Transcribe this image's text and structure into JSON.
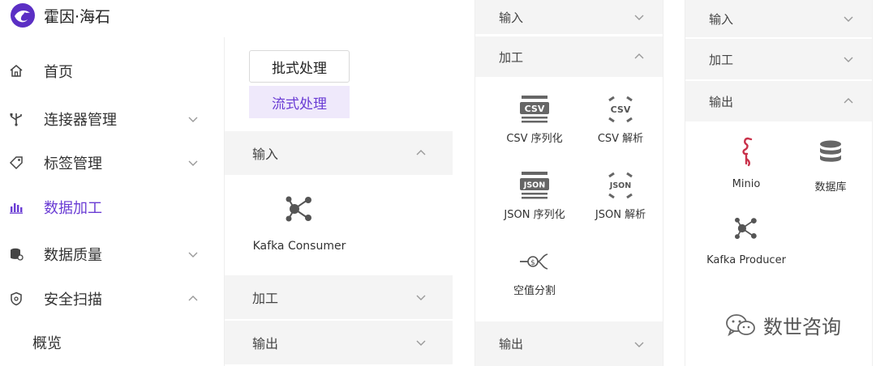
{
  "brand": {
    "name": "霍因·海石"
  },
  "sidebar": {
    "items": [
      {
        "label": "首页",
        "icon": "home-icon"
      },
      {
        "label": "连接器管理",
        "icon": "usb-connector-icon"
      },
      {
        "label": "标签管理",
        "icon": "tag-icon"
      },
      {
        "label": "数据加工",
        "icon": "bar-chart-icon"
      },
      {
        "label": "数据质量",
        "icon": "database-icon"
      },
      {
        "label": "安全扫描",
        "icon": "shield-icon"
      },
      {
        "label": "概览"
      }
    ]
  },
  "panel1": {
    "batch_label": "批式处理",
    "stream_label": "流式处理",
    "sections": {
      "input": "输入",
      "process": "加工",
      "output": "输出"
    },
    "tools": [
      {
        "label": "Kafka Consumer",
        "icon": "kafka-icon"
      }
    ]
  },
  "panel2": {
    "sections": {
      "input": "输入",
      "process": "加工",
      "output": "输出"
    },
    "tools": [
      {
        "label": "CSV 序列化",
        "icon": "csv-serialize-icon",
        "glyph": "CSV"
      },
      {
        "label": "CSV 解析",
        "icon": "csv-parse-icon",
        "glyph": "CSV"
      },
      {
        "label": "JSON 序列化",
        "icon": "json-serialize-icon",
        "glyph": "JSON"
      },
      {
        "label": "JSON 解析",
        "icon": "json-parse-icon",
        "glyph": "JSON"
      },
      {
        "label": "空值分割",
        "icon": "null-split-icon",
        "glyph": "$"
      }
    ]
  },
  "panel3": {
    "sections": {
      "input": "输入",
      "process": "加工",
      "output": "输出"
    },
    "tools": [
      {
        "label": "Minio",
        "icon": "flamingo-icon"
      },
      {
        "label": "数据库",
        "icon": "database-icon"
      },
      {
        "label": "Kafka Producer",
        "icon": "kafka-icon"
      }
    ]
  },
  "watermark": {
    "text": "数世咨询"
  },
  "colors": {
    "accent": "#6a3cd4",
    "accent_bg": "#efe9fb",
    "section_bg": "#f4f4f4",
    "icon_gray": "#666666",
    "minio_red": "#c9314a"
  }
}
